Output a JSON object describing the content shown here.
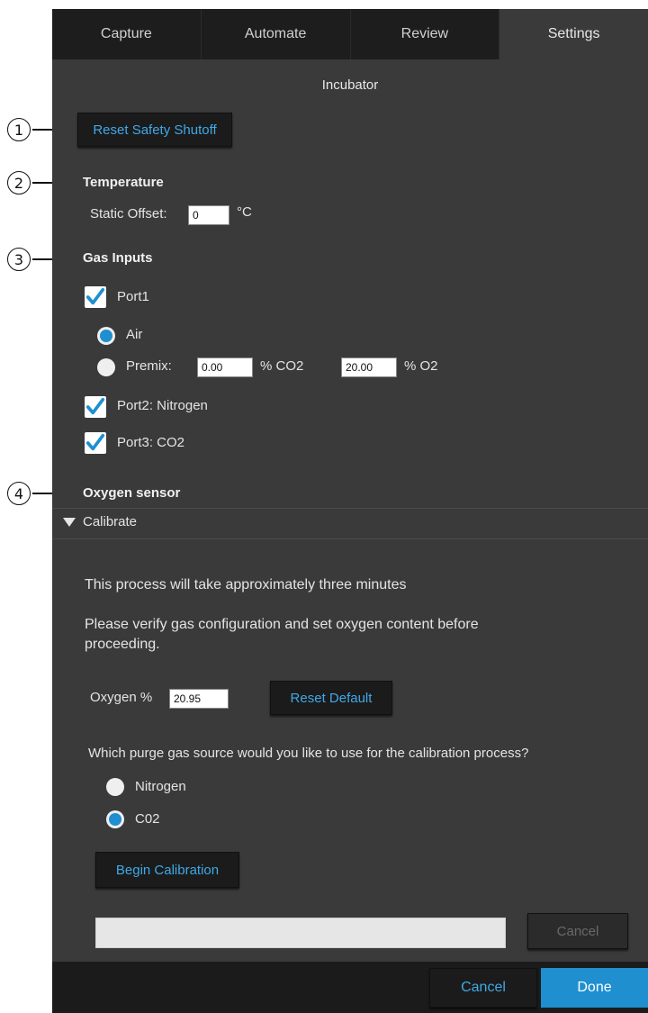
{
  "tabs": [
    "Capture",
    "Automate",
    "Review",
    "Settings"
  ],
  "section_title": "Incubator",
  "callouts": [
    "1",
    "2",
    "3",
    "4"
  ],
  "reset_safety_shutoff": "Reset Safety Shutoff",
  "temperature": {
    "heading": "Temperature",
    "offset_label": "Static Offset:",
    "offset_value": "0",
    "unit": "°C"
  },
  "gas_inputs": {
    "heading": "Gas Inputs",
    "port1_label": "Port1",
    "port1_checked": true,
    "air_label": "Air",
    "air_selected": true,
    "premix_label": "Premix:",
    "premix_selected": false,
    "co2_value": "0.00",
    "co2_unit": "% CO2",
    "o2_value": "20.00",
    "o2_unit": "% O2",
    "port2_label": "Port2: Nitrogen",
    "port2_checked": true,
    "port3_label": "Port3: CO2",
    "port3_checked": true
  },
  "oxygen_sensor": {
    "heading": "Oxygen sensor",
    "calibrate_label": "Calibrate",
    "info_line1": "This process will take approximately three minutes",
    "info_line2a": "Please verify gas configuration and set oxygen content before",
    "info_line2b": "proceeding.",
    "oxygen_label": "Oxygen %",
    "oxygen_value": "20.95",
    "reset_default": "Reset Default",
    "purge_question": "Which purge gas source would you like to use for the calibration process?",
    "nitrogen_label": "Nitrogen",
    "nitrogen_selected": false,
    "co2_label": "C02",
    "co2_selected": true,
    "begin_calibration": "Begin Calibration",
    "progress_cancel": "Cancel"
  },
  "footer": {
    "cancel": "Cancel",
    "done": "Done"
  },
  "colors": {
    "panel": "#3a3a3a",
    "tab_dark": "#1d1d1d",
    "accent": "#1f8fd0",
    "link_text": "#3fa9e8"
  }
}
